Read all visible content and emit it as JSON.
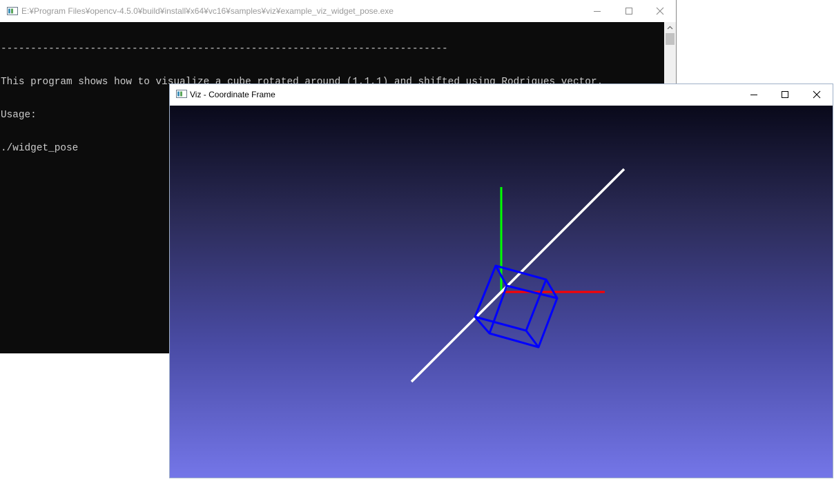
{
  "console": {
    "title": "E:¥Program Files¥opencv-4.5.0¥build¥install¥x64¥vc16¥samples¥viz¥example_viz_widget_pose.exe",
    "icon": "console-app-icon",
    "lines": [
      "---------------------------------------------------------------------------",
      "This program shows how to visualize a cube rotated around (1,1,1) and shifted using Rodrigues vector.",
      "Usage:",
      "./widget_pose"
    ]
  },
  "viz": {
    "title": "Viz - Coordinate Frame",
    "icon": "viz-app-icon",
    "background": {
      "top": "#09091a",
      "bottom": "#7476e8"
    },
    "scene": {
      "axis_colors": {
        "x": "#ff0000",
        "y": "#00ff00",
        "line": "#ffffff",
        "cube": "#0000ff"
      }
    }
  },
  "window_controls": {
    "minimize_icon": "minimize-icon",
    "maximize_icon": "maximize-icon",
    "close_icon": "close-icon"
  }
}
